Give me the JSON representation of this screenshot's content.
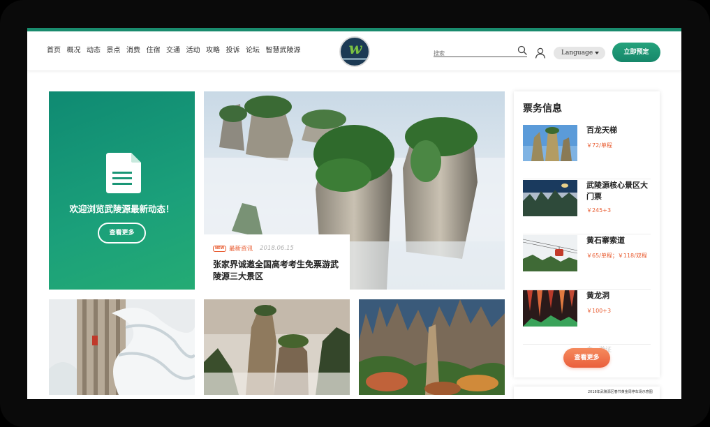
{
  "nav": {
    "items": [
      "首页",
      "概况",
      "动态",
      "景点",
      "消费",
      "住宿",
      "交通",
      "活动",
      "攻略",
      "投诉",
      "论坛",
      "智慧武陵源"
    ]
  },
  "header": {
    "logo_letter": "w",
    "search_placeholder": "搜索",
    "language_label": "Language",
    "book_label": "立即预定"
  },
  "welcome": {
    "title": "欢迎浏览武陵源最新动态！",
    "button": "查看更多"
  },
  "hero": {
    "badge": "NEW",
    "category": "最新资讯",
    "date": "2018.06.15",
    "title": "张家界诚邀全国高考考生免票游武陵源三大景区"
  },
  "tickets": {
    "title": "票务信息",
    "items": [
      {
        "name": "百龙天梯",
        "price": "￥72/单程"
      },
      {
        "name": "武陵源核心景区大门票",
        "price": "￥245+3"
      },
      {
        "name": "黄石寨索道",
        "price": "￥65/单程；￥118/双程"
      },
      {
        "name": "黄龙洞",
        "price": "￥100+3"
      }
    ],
    "more_label": "查看更多",
    "faded_item": "食…游证"
  },
  "bottom_notice": "2018年武陵源区春节黄金周停车场示意图",
  "colors": {
    "brand_green": "#1a8c6e",
    "accent_orange": "#e8592d"
  }
}
